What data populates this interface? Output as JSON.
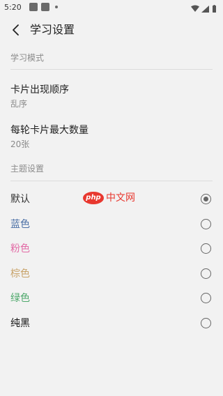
{
  "status_bar": {
    "time": "5:20"
  },
  "header": {
    "title": "学习设置"
  },
  "study_mode": {
    "section_title": "学习模式",
    "items": [
      {
        "title": "卡片出现顺序",
        "value": "乱序"
      },
      {
        "title": "每轮卡片最大数量",
        "value": "20张"
      }
    ]
  },
  "theme": {
    "section_title": "主题设置",
    "options": [
      {
        "label": "默认",
        "color": "#333333",
        "selected": true
      },
      {
        "label": "蓝色",
        "color": "#4a6fa5",
        "selected": false
      },
      {
        "label": "粉色",
        "color": "#e26aa5",
        "selected": false
      },
      {
        "label": "棕色",
        "color": "#c8a36a",
        "selected": false
      },
      {
        "label": "绿色",
        "color": "#4ea86b",
        "selected": false
      },
      {
        "label": "纯黑",
        "color": "#111111",
        "selected": false
      }
    ]
  },
  "watermark": {
    "badge": "php",
    "text": "中文网"
  }
}
